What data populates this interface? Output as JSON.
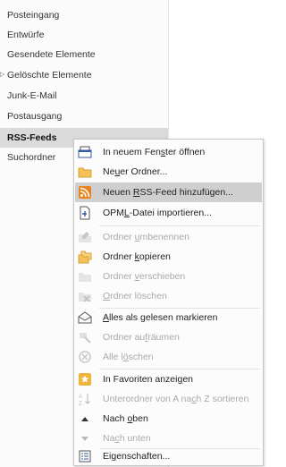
{
  "folders": [
    {
      "label": "Posteingang"
    },
    {
      "label": "Entwürfe"
    },
    {
      "label": "Gesendete Elemente"
    },
    {
      "label": "Gelöschte Elemente",
      "expander": "▷"
    },
    {
      "label": "Junk-E-Mail"
    },
    {
      "label": "Postausgang"
    },
    {
      "label": "RSS-Feeds",
      "selected": true
    },
    {
      "label": "Suchordner"
    }
  ],
  "menu": {
    "items": [
      {
        "pre": "In neuem Fen",
        "acc": "s",
        "post": "ter öffnen",
        "icon": "open-window-icon",
        "enabled": true
      },
      {
        "pre": "Ne",
        "acc": "u",
        "post": "er Ordner...",
        "icon": "new-folder-icon",
        "enabled": true
      },
      {
        "pre": "Neuen ",
        "acc": "R",
        "post": "SS-Feed hinzufügen...",
        "icon": "rss-icon",
        "enabled": true,
        "highlighted": true
      },
      {
        "pre": "OPM",
        "acc": "L",
        "post": "-Datei importieren...",
        "icon": "import-opml-icon",
        "enabled": true
      },
      {
        "pre": "Ordner ",
        "acc": "u",
        "post": "mbenennen",
        "icon": "rename-folder-icon",
        "enabled": false
      },
      {
        "pre": "Ordner ",
        "acc": "k",
        "post": "opieren",
        "icon": "copy-folder-icon",
        "enabled": true
      },
      {
        "pre": "Ordner ",
        "acc": "v",
        "post": "erschieben",
        "icon": "move-folder-icon",
        "enabled": false
      },
      {
        "pre": "",
        "acc": "O",
        "post": "rdner löschen",
        "icon": "delete-folder-icon",
        "enabled": false
      },
      {
        "pre": "",
        "acc": "A",
        "post": "lles als gelesen markieren",
        "icon": "mark-read-icon",
        "enabled": true
      },
      {
        "pre": "Ordner au",
        "acc": "f",
        "post": "räumen",
        "icon": "clean-up-icon",
        "enabled": false
      },
      {
        "pre": "Alle l",
        "acc": "ö",
        "post": "schen",
        "icon": "delete-all-icon",
        "enabled": false
      },
      {
        "pre": "In Favoriten anzei",
        "acc": "g",
        "post": "en",
        "icon": "favorite-star-icon",
        "enabled": true
      },
      {
        "pre": "Unterordner von A na",
        "acc": "c",
        "post": "h Z sortieren",
        "icon": "sort-az-icon",
        "enabled": false
      },
      {
        "pre": "Nach ",
        "acc": "o",
        "post": "ben",
        "icon": "triangle-up-icon",
        "enabled": true
      },
      {
        "pre": "Na",
        "acc": "c",
        "post": "h unten",
        "icon": "triangle-down-icon",
        "enabled": false
      },
      {
        "pre": "Ei",
        "acc": "g",
        "post": "enschaften...",
        "icon": "properties-icon",
        "enabled": true
      }
    ]
  }
}
